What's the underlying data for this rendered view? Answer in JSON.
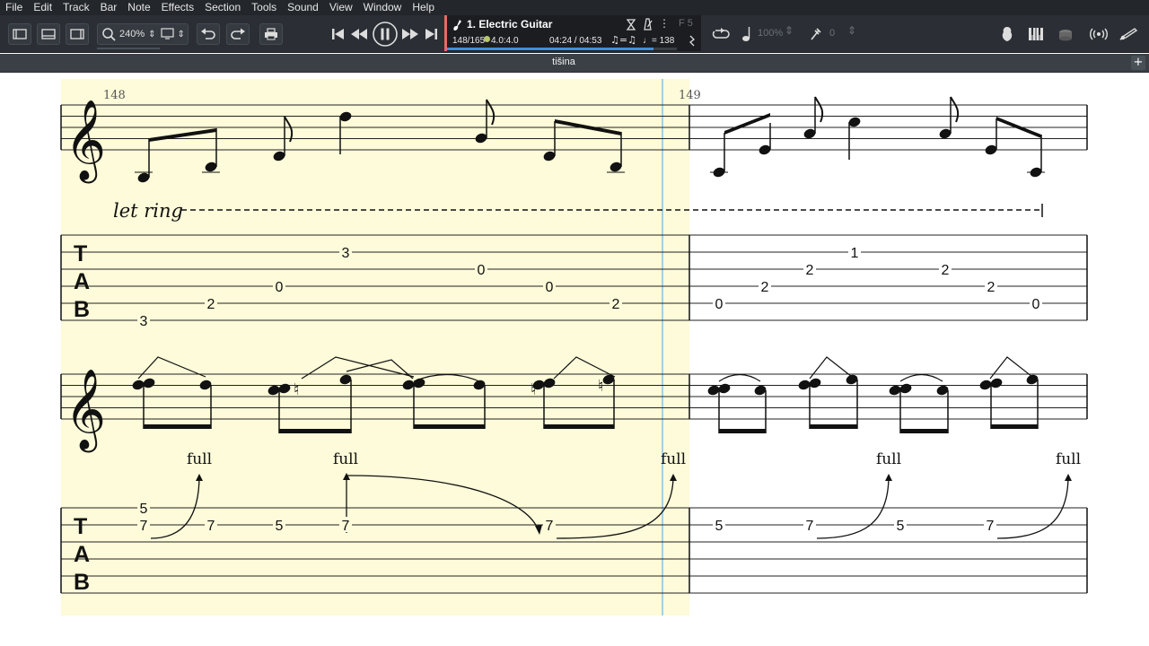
{
  "menu": {
    "items": [
      "File",
      "Edit",
      "Track",
      "Bar",
      "Note",
      "Effects",
      "Section",
      "Tools",
      "Sound",
      "View",
      "Window",
      "Help"
    ]
  },
  "toolbar": {
    "zoom_value": "240%"
  },
  "track": {
    "name": "1. Electric Guitar",
    "position": "148/165",
    "beat": "4.0:4.0",
    "time": "04:24 / 04:53",
    "swing": "♫=♫",
    "tempo": "♩= 138",
    "key": "F 5",
    "progress": 0.9
  },
  "right_toolbar": {
    "speed": "100%",
    "tuner_value": "0"
  },
  "document": {
    "title": "tišina"
  },
  "score": {
    "bars": [
      {
        "number": "148"
      },
      {
        "number": "149"
      }
    ],
    "let_ring": "let ring",
    "tab_clef": [
      "T",
      "A",
      "B"
    ],
    "tab1_bar148": [
      {
        "fret": "3",
        "string": 6,
        "pos": 0
      },
      {
        "fret": "2",
        "string": 5,
        "pos": 1
      },
      {
        "fret": "0",
        "string": 4,
        "pos": 2
      },
      {
        "fret": "3",
        "string": 2,
        "pos": 3
      },
      {
        "fret": "0",
        "string": 3,
        "pos": 4
      },
      {
        "fret": "0",
        "string": 4,
        "pos": 5
      },
      {
        "fret": "2",
        "string": 5,
        "pos": 6
      }
    ],
    "tab1_bar149": [
      {
        "fret": "0",
        "string": 5,
        "pos": 0
      },
      {
        "fret": "2",
        "string": 4,
        "pos": 1
      },
      {
        "fret": "2",
        "string": 3,
        "pos": 2
      },
      {
        "fret": "1",
        "string": 2,
        "pos": 3
      },
      {
        "fret": "2",
        "string": 3,
        "pos": 4
      },
      {
        "fret": "2",
        "string": 4,
        "pos": 5
      },
      {
        "fret": "0",
        "string": 5,
        "pos": 6
      }
    ],
    "bend_label": "full",
    "tab2_bar148": [
      {
        "fret": "5",
        "string": 1,
        "pos": 0
      },
      {
        "fret": "7",
        "string": 2,
        "pos": 0
      },
      {
        "fret": "7",
        "string": 2,
        "pos": 1
      },
      {
        "fret": "5",
        "string": 2,
        "pos": 2
      },
      {
        "fret": "7",
        "string": 2,
        "pos": 3
      },
      {
        "fret": "7",
        "string": 2,
        "pos": 4
      }
    ],
    "tab2_bar149": [
      {
        "fret": "5",
        "string": 2,
        "pos": 0
      },
      {
        "fret": "7",
        "string": 2,
        "pos": 1
      },
      {
        "fret": "5",
        "string": 2,
        "pos": 2
      },
      {
        "fret": "7",
        "string": 2,
        "pos": 3
      }
    ]
  },
  "colors": {
    "highlight": "#fdfbd9",
    "accent": "#3f8fdc",
    "track_marker": "#e56a6a"
  }
}
